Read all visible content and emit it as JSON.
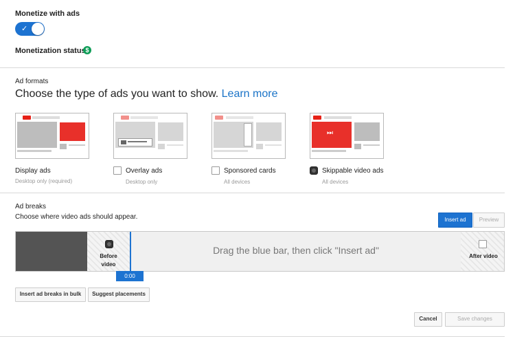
{
  "monetize": {
    "title": "Monetize with ads",
    "toggle_on": true,
    "status_label": "Monetization status:",
    "status_icon": "dollar-icon",
    "status_color": "#0f9d58"
  },
  "ad_formats": {
    "section_label": "Ad formats",
    "heading": "Choose the type of ads you want to show.",
    "learn_more": "Learn more",
    "items": [
      {
        "label": "Display ads",
        "sub": "Desktop only (required)",
        "has_checkbox": false,
        "checked": false
      },
      {
        "label": "Overlay ads",
        "sub": "Desktop only",
        "has_checkbox": true,
        "checked": false
      },
      {
        "label": "Sponsored cards",
        "sub": "All devices",
        "has_checkbox": true,
        "checked": false
      },
      {
        "label": "Skippable video ads",
        "sub": "All devices",
        "has_checkbox": true,
        "checked": true
      }
    ]
  },
  "ad_breaks": {
    "section_label": "Ad breaks",
    "description": "Choose where video ads should appear.",
    "insert_ad": "Insert ad",
    "preview": "Preview",
    "drag_hint": "Drag the blue bar, then click \"Insert ad\"",
    "before_video": "Before video",
    "after_video": "After video",
    "before_checked": true,
    "after_checked": false,
    "playhead_time": "0:00",
    "insert_bulk": "Insert ad breaks in bulk",
    "suggest_placements": "Suggest placements"
  },
  "footer": {
    "cancel": "Cancel",
    "save": "Save changes"
  },
  "colors": {
    "accent": "#1d73d1",
    "youtube_red": "#e62117",
    "ad_red": "#e8302a"
  }
}
